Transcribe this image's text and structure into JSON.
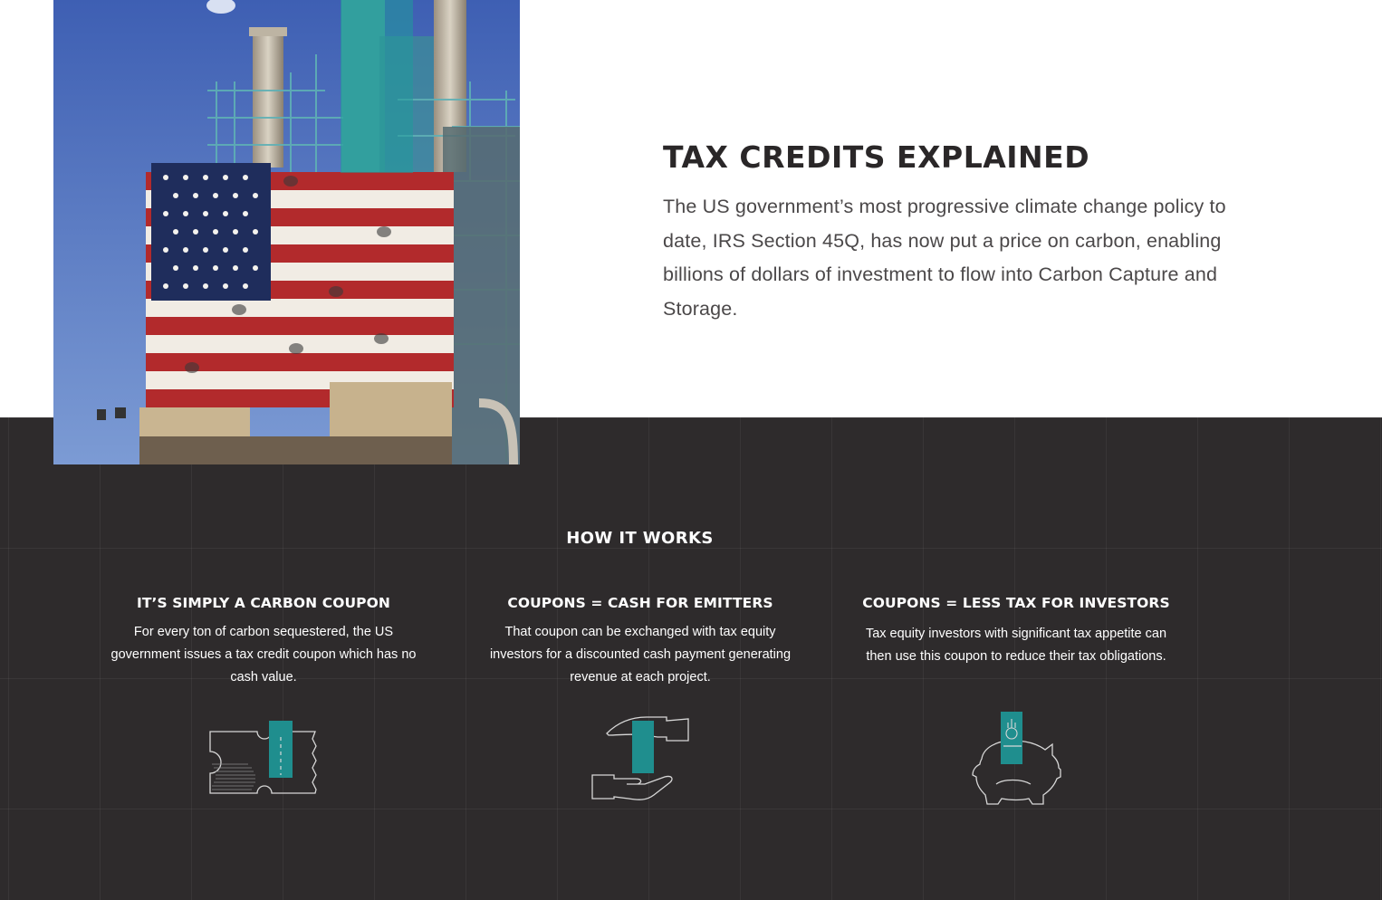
{
  "intro": {
    "title": "TAX CREDITS EXPLAINED",
    "body": "The US government’s most progressive climate change policy to date, IRS Section 45Q, has now put a price on carbon, enabling billions of dollars of investment to flow into Carbon Capture and Storage."
  },
  "how_it_works": {
    "title": "HOW IT WORKS",
    "columns": [
      {
        "title": "IT’S SIMPLY A CARBON COUPON",
        "body": "For every ton of carbon sequestered, the US government issues a tax credit coupon which has no cash value.",
        "icon": "coupon-icon"
      },
      {
        "title": "COUPONS = CASH FOR EMITTERS",
        "body": "That coupon can be exchanged with tax equity investors for a discounted cash payment generating revenue at each project.",
        "icon": "hands-exchange-icon"
      },
      {
        "title": "COUPONS = LESS TAX FOR INVESTORS",
        "body": "Tax equity investors with significant tax appetite can then use this coupon to reduce their tax obligations.",
        "icon": "piggy-bank-icon"
      }
    ]
  },
  "colors": {
    "dark_bg": "#2e2b2c",
    "accent_teal": "#1f8e8e",
    "title_dark": "#2a2728",
    "body_gray": "#4b4849"
  },
  "hero_image": {
    "icon": "power-plant-flag-photo"
  }
}
